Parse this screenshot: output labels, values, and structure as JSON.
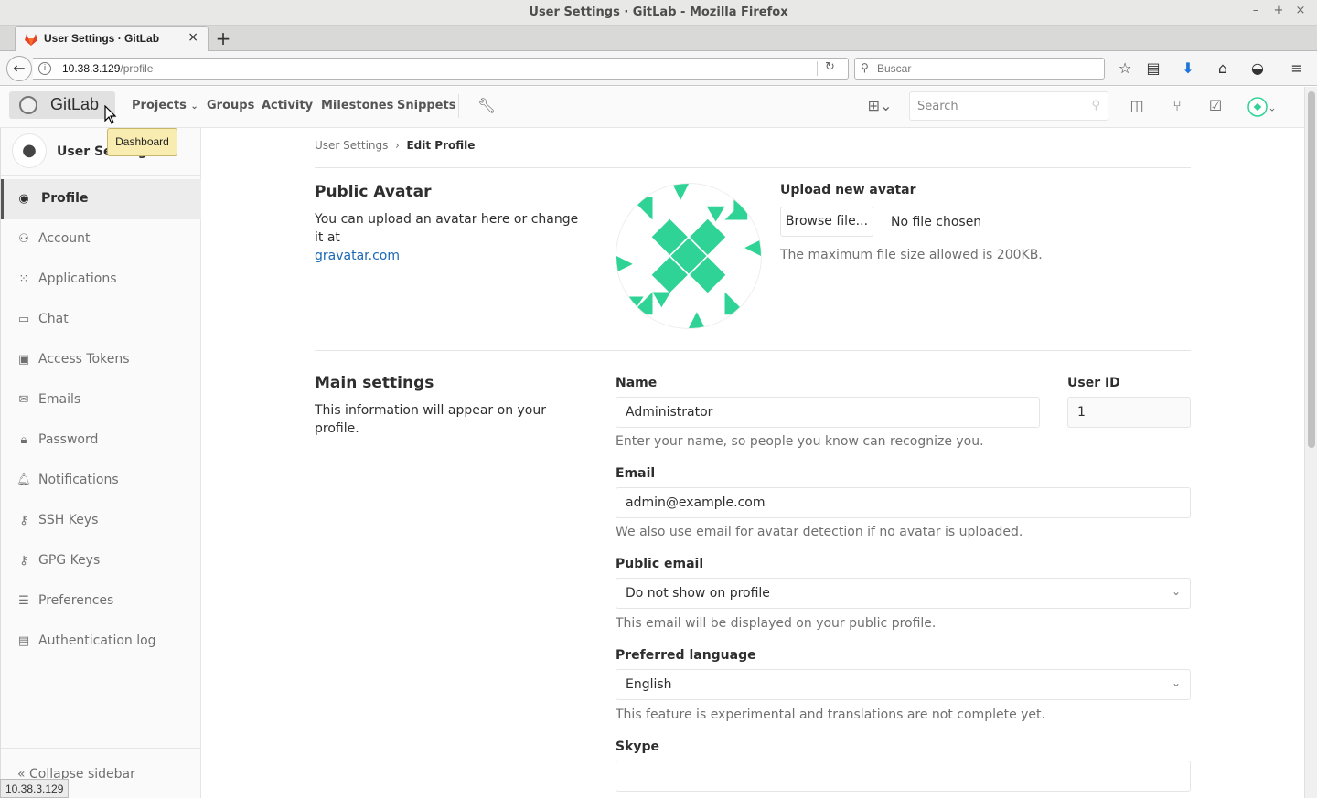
{
  "window": {
    "title": "User Settings · GitLab - Mozilla Firefox"
  },
  "browser": {
    "tab_label": "User Settings · GitLab",
    "url_host": "10.38.3.129",
    "url_path": "/profile",
    "search_placeholder": "Buscar",
    "status_text": "10.38.3.129"
  },
  "gitlab_header": {
    "logo_text": "GitLab",
    "nav": [
      "Projects",
      "Groups",
      "Activity",
      "Milestones",
      "Snippets"
    ],
    "search_placeholder": "Search",
    "tooltip": "Dashboard"
  },
  "sidebar": {
    "title": "User Settings",
    "items": [
      {
        "label": "Profile",
        "icon": "profile-icon",
        "active": true
      },
      {
        "label": "Account",
        "icon": "account-icon"
      },
      {
        "label": "Applications",
        "icon": "applications-icon"
      },
      {
        "label": "Chat",
        "icon": "chat-icon"
      },
      {
        "label": "Access Tokens",
        "icon": "access-token-icon"
      },
      {
        "label": "Emails",
        "icon": "email-icon"
      },
      {
        "label": "Password",
        "icon": "lock-icon"
      },
      {
        "label": "Notifications",
        "icon": "bell-icon"
      },
      {
        "label": "SSH Keys",
        "icon": "key-icon"
      },
      {
        "label": "GPG Keys",
        "icon": "key-icon"
      },
      {
        "label": "Preferences",
        "icon": "sliders-icon"
      },
      {
        "label": "Authentication log",
        "icon": "log-icon"
      }
    ],
    "collapse_label": "Collapse sidebar"
  },
  "breadcrumb": {
    "parent": "User Settings",
    "current": "Edit Profile"
  },
  "avatar_section": {
    "title": "Public Avatar",
    "desc": "You can upload an avatar here or change it at",
    "link": "gravatar.com",
    "upload_label": "Upload new avatar",
    "browse_label": "Browse file...",
    "no_file": "No file chosen",
    "max_size": "The maximum file size allowed is 200KB.",
    "avatar_color": "#2ed395"
  },
  "main_settings": {
    "title": "Main settings",
    "desc": "This information will appear on your profile.",
    "name_label": "Name",
    "name_value": "Administrator",
    "name_help": "Enter your name, so people you know can recognize you.",
    "userid_label": "User ID",
    "userid_value": "1",
    "email_label": "Email",
    "email_value": "admin@example.com",
    "email_help": "We also use email for avatar detection if no avatar is uploaded.",
    "public_email_label": "Public email",
    "public_email_value": "Do not show on profile",
    "public_email_help": "This email will be displayed on your public profile.",
    "language_label": "Preferred language",
    "language_value": "English",
    "language_help": "This feature is experimental and translations are not complete yet.",
    "skype_label": "Skype",
    "skype_value": ""
  }
}
